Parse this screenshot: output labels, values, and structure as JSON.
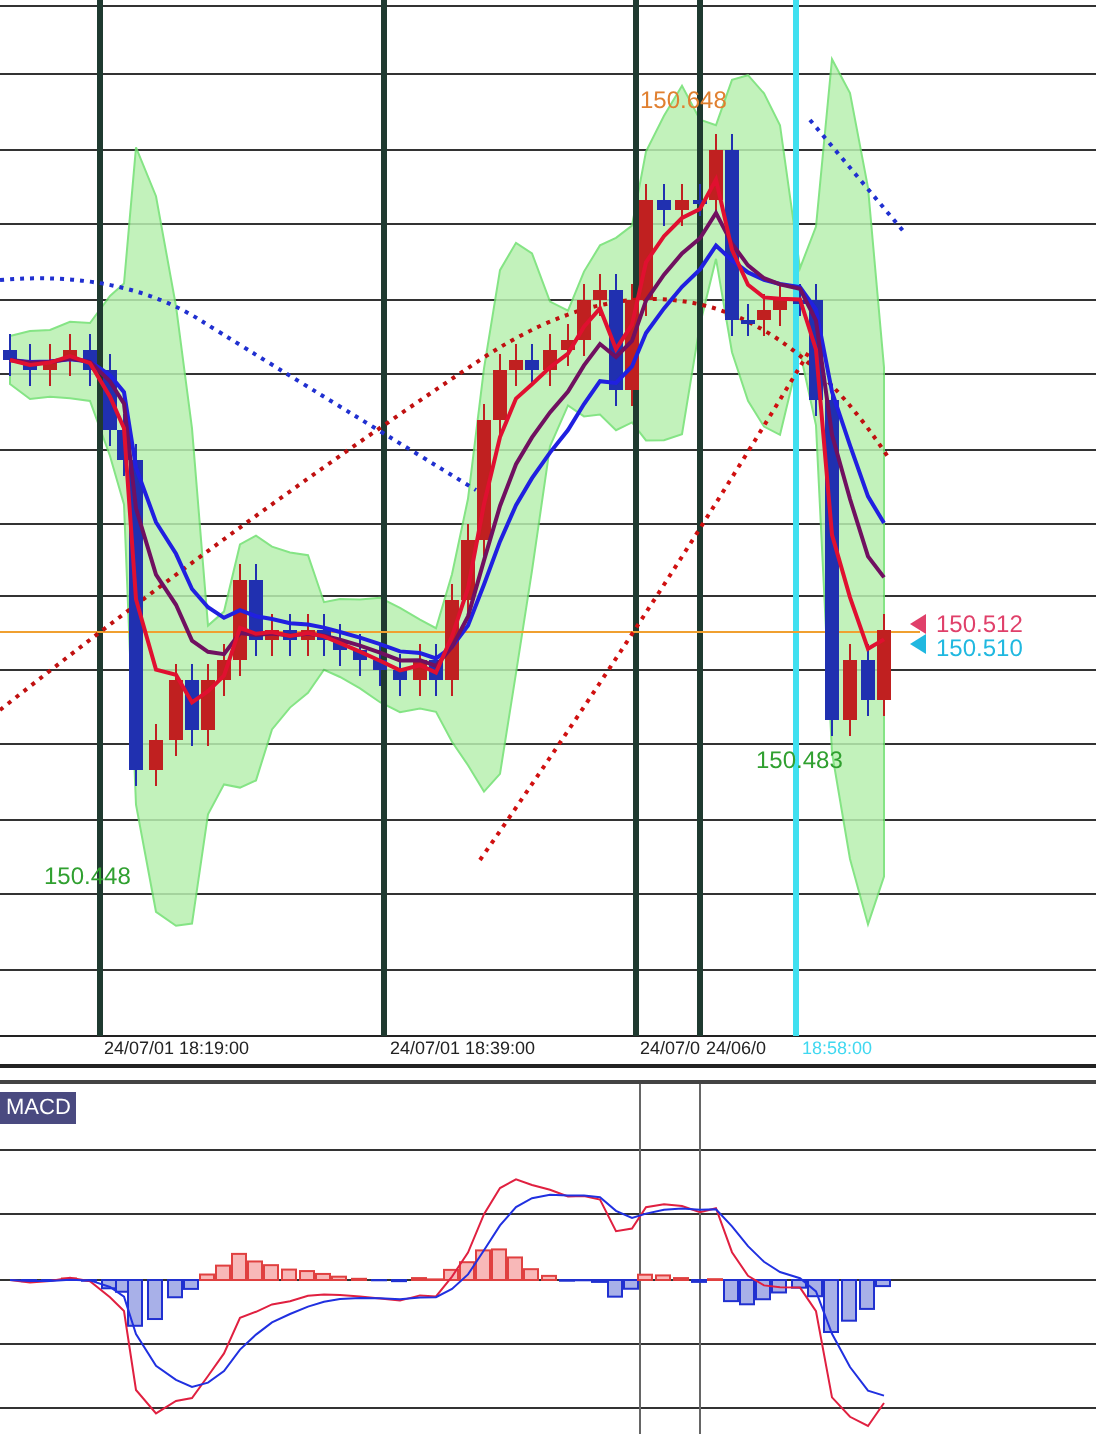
{
  "price_chart": {
    "price_labels": [
      {
        "kind": "high",
        "text": "150.648"
      },
      {
        "kind": "low",
        "text": "150.448"
      },
      {
        "kind": "low",
        "text": "150.483"
      }
    ],
    "current_prices": [
      {
        "text": "150.512",
        "color": "#e0406a"
      },
      {
        "text": "150.510",
        "color": "#20b8e0"
      }
    ],
    "time_labels": [
      {
        "text": "24/07/01 18:19:00",
        "selected": false
      },
      {
        "text": "24/07/01 18:39:00",
        "selected": false
      },
      {
        "text": "24/07/0",
        "selected": false
      },
      {
        "text": "24/06/0",
        "selected": false
      },
      {
        "text": "18:58:00",
        "selected": true
      }
    ]
  },
  "indicator_panel": {
    "title": "MACD"
  }
}
